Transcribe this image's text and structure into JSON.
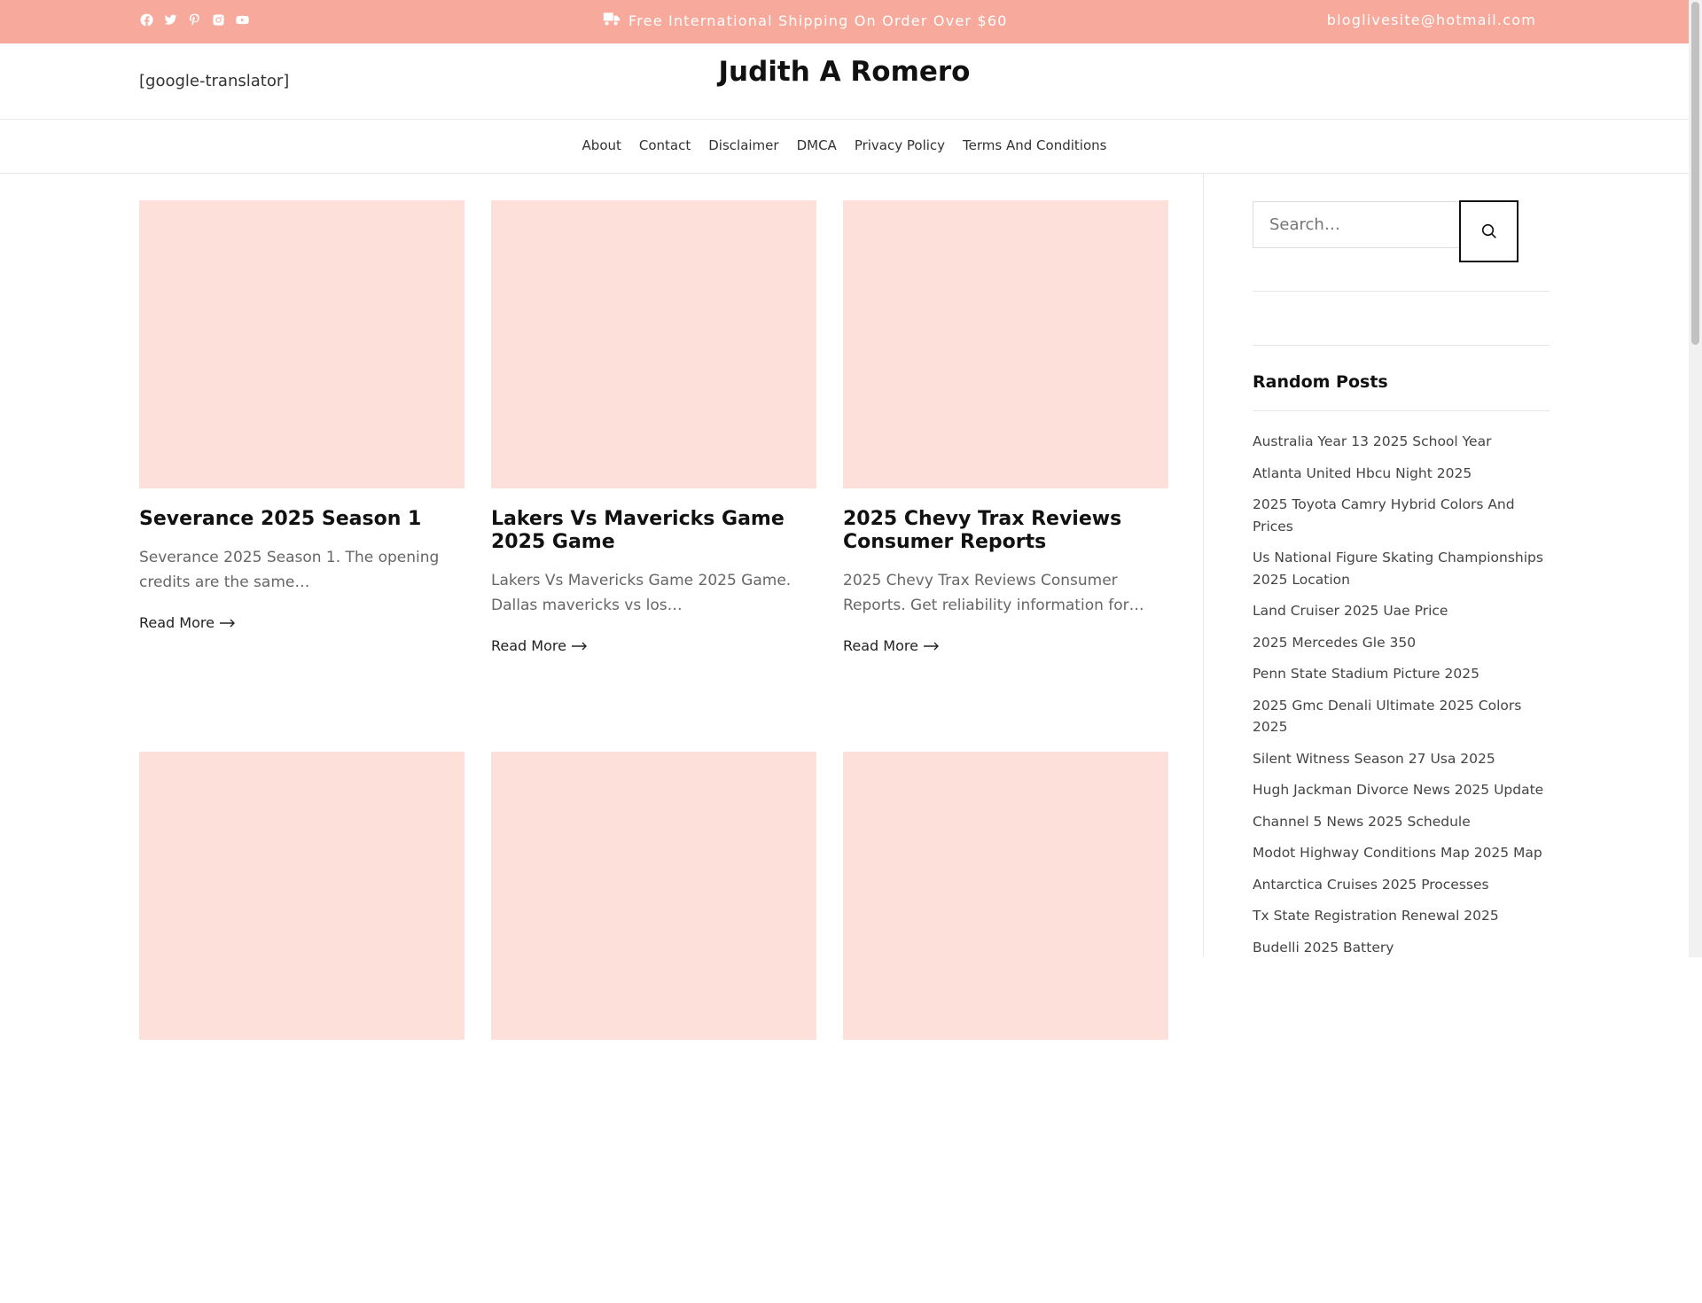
{
  "topbar": {
    "socials": [
      "facebook-icon",
      "twitter-icon",
      "pinterest-icon",
      "instagram-icon",
      "youtube-icon"
    ],
    "shipping_text": "Free International Shipping On Order Over $60",
    "email": "bloglivesite@hotmail.com",
    "background": "#f7a99b"
  },
  "header": {
    "translator": "[google-translator]",
    "site_title": "Judith A Romero"
  },
  "nav": {
    "items": [
      "About",
      "Contact",
      "Disclaimer",
      "DMCA",
      "Privacy Policy",
      "Terms And Conditions"
    ]
  },
  "posts": [
    {
      "title": "Severance 2025 Season 1",
      "excerpt": "Severance 2025 Season 1. The opening credits are the same…",
      "read_more": "Read More"
    },
    {
      "title": "Lakers Vs Mavericks Game 2025 Game",
      "excerpt": "Lakers Vs Mavericks Game 2025 Game. Dallas mavericks vs los…",
      "read_more": "Read More"
    },
    {
      "title": "2025 Chevy Trax Reviews Consumer Reports",
      "excerpt": "2025 Chevy Trax Reviews Consumer Reports. Get reliability information for…",
      "read_more": "Read More"
    }
  ],
  "sidebar": {
    "search_placeholder": "Search…",
    "widget_title": "Random Posts",
    "random_posts": [
      "Australia Year 13 2025 School Year",
      "Atlanta United Hbcu Night 2025",
      "2025 Toyota Camry Hybrid Colors And Prices",
      "Us National Figure Skating Championships 2025 Location",
      "Land Cruiser 2025 Uae Price",
      "2025 Mercedes Gle 350",
      "Penn State Stadium Picture 2025",
      "2025 Gmc Denali Ultimate 2025 Colors 2025",
      "Silent Witness Season 27 Usa 2025",
      "Hugh Jackman Divorce News 2025 Update",
      "Channel 5 News 2025 Schedule",
      "Modot Highway Conditions Map 2025 Map",
      "Antarctica Cruises 2025 Processes",
      "Tx State Registration Renewal 2025",
      "Budelli 2025 Battery"
    ]
  },
  "colors": {
    "accent": "#f7a99b",
    "thumb_placeholder": "#fde0da"
  }
}
